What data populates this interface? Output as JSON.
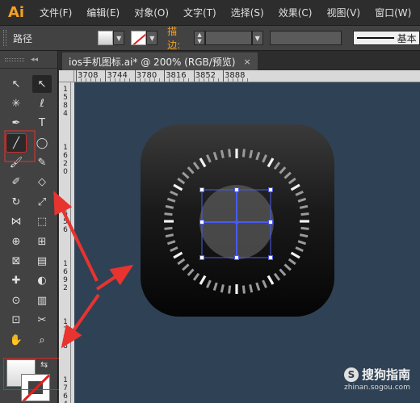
{
  "app": {
    "logo": "Ai"
  },
  "menu": [
    "文件(F)",
    "编辑(E)",
    "对象(O)",
    "文字(T)",
    "选择(S)",
    "效果(C)",
    "视图(V)",
    "窗口(W)"
  ],
  "control_bar": {
    "selection_label": "路径",
    "stroke_label": "描边:",
    "profile_label": "基本"
  },
  "document_tab": {
    "title": "ios手机图标.ai* @ 200% (RGB/预览)",
    "close": "×"
  },
  "ruler": {
    "horizontal_labels": [
      "3708",
      "3744",
      "3780",
      "3816",
      "3852",
      "3888"
    ],
    "vertical_labels": [
      "1584",
      "1620",
      "1656",
      "1692",
      "1728",
      "1764"
    ]
  },
  "tools": [
    {
      "name": "selection-tool",
      "glyph": "↖"
    },
    {
      "name": "direct-selection-tool",
      "glyph": "↖"
    },
    {
      "name": "magic-wand-tool",
      "glyph": "✳"
    },
    {
      "name": "lasso-tool",
      "glyph": "ℓ"
    },
    {
      "name": "pen-tool",
      "glyph": "✒"
    },
    {
      "name": "type-tool",
      "glyph": "T"
    },
    {
      "name": "line-segment-tool",
      "glyph": "╱"
    },
    {
      "name": "ellipse-tool",
      "glyph": "◯"
    },
    {
      "name": "paintbrush-tool",
      "glyph": "🖌"
    },
    {
      "name": "pencil-tool",
      "glyph": "✎"
    },
    {
      "name": "blob-brush-tool",
      "glyph": "✐"
    },
    {
      "name": "eraser-tool",
      "glyph": "◇"
    },
    {
      "name": "rotate-tool",
      "glyph": "↻"
    },
    {
      "name": "scale-tool",
      "glyph": "⤢"
    },
    {
      "name": "width-tool",
      "glyph": "⋈"
    },
    {
      "name": "free-transform-tool",
      "glyph": "⬚"
    },
    {
      "name": "shape-builder-tool",
      "glyph": "⊕"
    },
    {
      "name": "perspective-grid-tool",
      "glyph": "⊞"
    },
    {
      "name": "mesh-tool",
      "glyph": "⊠"
    },
    {
      "name": "gradient-tool",
      "glyph": "▤"
    },
    {
      "name": "eyedropper-tool",
      "glyph": "✚"
    },
    {
      "name": "blend-tool",
      "glyph": "◐"
    },
    {
      "name": "symbol-sprayer-tool",
      "glyph": "⊙"
    },
    {
      "name": "column-graph-tool",
      "glyph": "▥"
    },
    {
      "name": "artboard-tool",
      "glyph": "⊡"
    },
    {
      "name": "slice-tool",
      "glyph": "✂"
    },
    {
      "name": "hand-tool",
      "glyph": "✋"
    },
    {
      "name": "zoom-tool",
      "glyph": "⌕"
    }
  ],
  "colors": {
    "canvas": "#2f4154",
    "accent": "#f7a020",
    "annotation": "#e8332f",
    "selection": "#4a5af0"
  },
  "watermark": {
    "main": "搜狗指南",
    "sub": "zhinan.sogou.com"
  }
}
